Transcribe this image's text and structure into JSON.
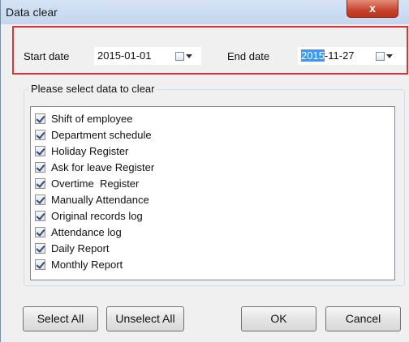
{
  "window": {
    "title": "Data clear",
    "close_label": "x"
  },
  "dates": {
    "start_label": "Start date",
    "start_value": "2015-01-01",
    "end_label": "End date",
    "end_value_selected": "2015",
    "end_value_rest": "-11-27"
  },
  "group": {
    "title": "Please select data to clear",
    "items": [
      "Shift of employee",
      "Department schedule",
      "Holiday Register",
      "Ask for leave Register",
      "Overtime  Register",
      "Manually Attendance",
      "Original records log",
      "Attendance log",
      "Daily Report",
      "Monthly Report"
    ]
  },
  "buttons": {
    "select_all": "Select All",
    "unselect_all": "Unselect All",
    "ok": "OK",
    "cancel": "Cancel"
  },
  "colors": {
    "highlight_border": "#e0303a",
    "selection": "#3399ff"
  },
  "icons": [
    "calendar-dropdown-icon",
    "close-icon",
    "checkbox-checked-icon"
  ]
}
